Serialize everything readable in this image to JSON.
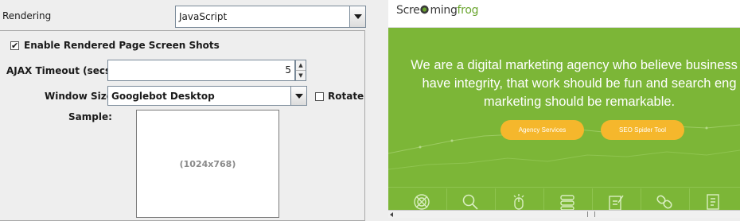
{
  "rendering": {
    "label": "Rendering",
    "mode": "JavaScript"
  },
  "screenshots": {
    "checkbox_label": "Enable Rendered Page Screen Shots",
    "checked": true,
    "ajax_timeout_label": "AJAX Timeout (secs):",
    "ajax_timeout_value": "5",
    "window_size_label": "Window Size:",
    "window_size_value": "Googlebot Desktop",
    "rotate_label": "Rotate",
    "rotate_checked": false,
    "sample_label": "Sample:",
    "sample_dimensions": "(1024x768)"
  },
  "preview": {
    "logo_part1": "Scre",
    "logo_part2": "ming",
    "logo_part3": "frog",
    "hero_lines": [
      "We are a digital marketing agency who believe business s",
      "have integrity, that work should be fun and search eng",
      "marketing should be remarkable."
    ],
    "buttons": [
      "Agency Services",
      "SEO Spider Tool"
    ],
    "icons": [
      "target-icon",
      "magnifier-icon",
      "mouse-pointer-icon",
      "stack-icon",
      "document-pencil-icon",
      "link-chain-icon",
      "report-icon"
    ],
    "colors": {
      "hero_green": "#7cb637",
      "button_orange": "#f5b72c"
    }
  }
}
